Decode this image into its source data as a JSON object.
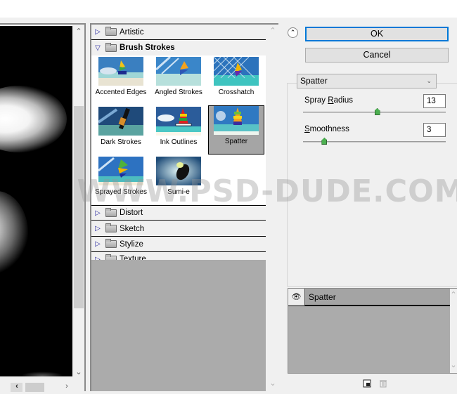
{
  "buttons": {
    "ok": "OK",
    "cancel": "Cancel"
  },
  "categories": [
    {
      "label": "Artistic",
      "expanded": false
    },
    {
      "label": "Brush Strokes",
      "expanded": true
    },
    {
      "label": "Distort",
      "expanded": false
    },
    {
      "label": "Sketch",
      "expanded": false
    },
    {
      "label": "Stylize",
      "expanded": false
    },
    {
      "label": "Texture",
      "expanded": false
    }
  ],
  "brush_strokes_filters": [
    {
      "label": "Accented Edges",
      "selected": false
    },
    {
      "label": "Angled Strokes",
      "selected": false
    },
    {
      "label": "Crosshatch",
      "selected": false
    },
    {
      "label": "Dark Strokes",
      "selected": false
    },
    {
      "label": "Ink Outlines",
      "selected": false
    },
    {
      "label": "Spatter",
      "selected": true
    },
    {
      "label": "Sprayed Strokes",
      "selected": false
    },
    {
      "label": "Sumi-e",
      "selected": false
    }
  ],
  "settings": {
    "filter_select": "Spatter",
    "params": [
      {
        "label_pre": "Spray ",
        "mnemonic": "R",
        "label_post": "adius",
        "value": "13",
        "slider_fraction": 0.52
      },
      {
        "label_pre": "",
        "mnemonic": "S",
        "label_post": "moothness",
        "value": "3",
        "slider_fraction": 0.15
      }
    ]
  },
  "effect_layers": [
    {
      "name": "Spatter",
      "visible": true
    }
  ],
  "watermark": "WWW.PSD-DUDE.COM",
  "icons": {
    "collapse": "double-chevron-up-icon",
    "new_layer": "new-effect-layer-icon",
    "delete": "trash-icon",
    "eye": "eye-icon",
    "folder": "folder-icon"
  }
}
